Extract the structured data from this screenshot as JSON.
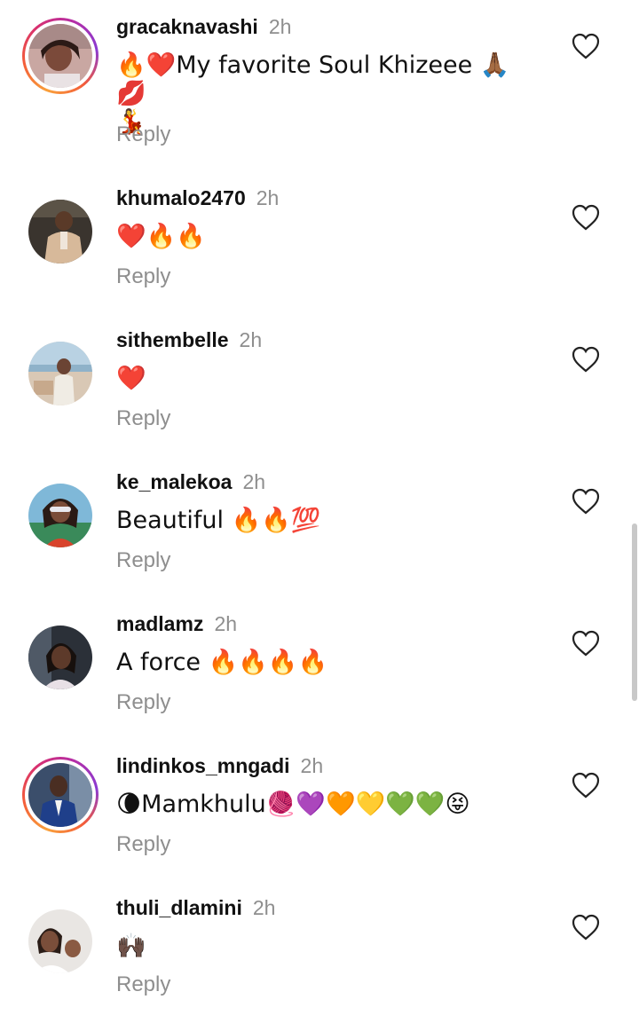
{
  "comments": [
    {
      "username": "gracaknavashi",
      "time": "2h",
      "text": "🔥❤️My favorite Soul Khizeee 🙏🏾💋\n💃",
      "reply": "Reply",
      "avatar": "woman-portrait-avatar",
      "story_ring": true
    },
    {
      "username": "khumalo2470",
      "time": "2h",
      "text": "❤️🔥🔥",
      "reply": "Reply",
      "avatar": "man-in-suit-avatar",
      "story_ring": false
    },
    {
      "username": "sithembelle",
      "time": "2h",
      "text": "❤️",
      "reply": "Reply",
      "avatar": "woman-at-beach-avatar",
      "story_ring": false
    },
    {
      "username": "ke_malekoa",
      "time": "2h",
      "text": "Beautiful 🔥🔥💯",
      "reply": "Reply",
      "avatar": "woman-sunglasses-avatar",
      "story_ring": false
    },
    {
      "username": "madlamz",
      "time": "2h",
      "text": "A  force 🔥🔥🔥🔥",
      "reply": "Reply",
      "avatar": "woman-in-car-avatar",
      "story_ring": false
    },
    {
      "username": "lindinkos_mngadi",
      "time": "2h",
      "text": "🌘Mamkhulu🧶💜🧡💛💚💚😝",
      "reply": "Reply",
      "avatar": "man-in-blue-suit-avatar",
      "story_ring": true
    },
    {
      "username": "thuli_dlamini",
      "time": "2h",
      "text": "🙌🏿",
      "reply": "Reply",
      "avatar": "mother-and-child-avatar",
      "story_ring": false
    }
  ],
  "colors": {
    "text": "#111111",
    "muted": "#8e8e8e",
    "background": "#ffffff",
    "story_ring": [
      "#f9a03b",
      "#d8306f",
      "#8a3ad2"
    ]
  },
  "icons": {
    "like": "heart-outline-icon"
  }
}
